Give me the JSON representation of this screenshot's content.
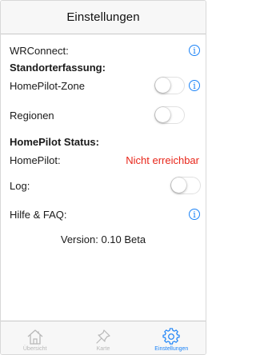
{
  "navbar": {
    "title": "Einstellungen"
  },
  "settings": {
    "wrconnect_label": "WRConnect:",
    "standort_heading": "Standorterfassung:",
    "homepilot_zone_label": "HomePilot-Zone",
    "regionen_label": "Regionen",
    "status_heading": "HomePilot Status:",
    "homepilot_label": "HomePilot:",
    "homepilot_status": "Nicht erreichbar",
    "log_label": "Log:",
    "help_label": "Hilfe & FAQ:",
    "version": "Version: 0.10 Beta",
    "info_glyph": "i"
  },
  "toggles": {
    "homepilot_zone": false,
    "regionen": false,
    "log": false
  },
  "colors": {
    "accent": "#1a82f7",
    "status_red": "#e8261a",
    "inactive_tab": "#b8b8b8"
  },
  "tabbar": {
    "tabs": [
      {
        "label": "Übersicht",
        "icon": "house-icon",
        "active": false
      },
      {
        "label": "Karte",
        "icon": "pin-icon",
        "active": false
      },
      {
        "label": "Einstellungen",
        "icon": "gear-icon",
        "active": true
      }
    ]
  }
}
